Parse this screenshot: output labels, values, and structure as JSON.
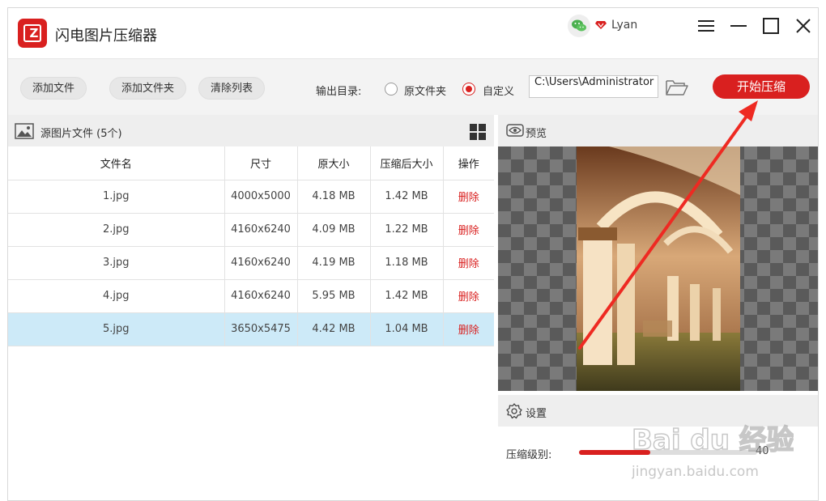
{
  "app": {
    "title": "闪电图片压缩器"
  },
  "user": {
    "name": "Lyan"
  },
  "toolbar": {
    "add_file": "添加文件",
    "add_folder": "添加文件夹",
    "clear_list": "清除列表",
    "output_label": "输出目录:",
    "option_original": "原文件夹",
    "option_custom": "自定义",
    "selected_option": "custom",
    "path_value": "C:\\Users\\Administrator",
    "start_button": "开始压缩"
  },
  "file_panel": {
    "title": "源图片文件 (5个)",
    "columns": [
      "文件名",
      "尺寸",
      "原大小",
      "压缩后大小",
      "操作"
    ],
    "rows": [
      {
        "name": "1.jpg",
        "size": "4000x5000",
        "original": "4.18 MB",
        "compressed": "1.42 MB",
        "action": "删除"
      },
      {
        "name": "2.jpg",
        "size": "4160x6240",
        "original": "4.09 MB",
        "compressed": "1.22 MB",
        "action": "删除"
      },
      {
        "name": "3.jpg",
        "size": "4160x6240",
        "original": "4.19 MB",
        "compressed": "1.18 MB",
        "action": "删除"
      },
      {
        "name": "4.jpg",
        "size": "4160x6240",
        "original": "5.95 MB",
        "compressed": "1.42 MB",
        "action": "删除"
      },
      {
        "name": "5.jpg",
        "size": "3650x5475",
        "original": "4.42 MB",
        "compressed": "1.04 MB",
        "action": "删除"
      }
    ],
    "selected_row": 4
  },
  "preview": {
    "title": "预览"
  },
  "settings": {
    "title": "设置",
    "level_label": "压缩级别:",
    "level_value": "40",
    "level_fraction": 0.4
  },
  "watermark": {
    "text": "Bai du 经验",
    "url_text": "jingyan.baidu.com"
  },
  "colors": {
    "accent": "#d9201f",
    "selected_row": "#cdeaf8",
    "header_bg": "#eeeeee",
    "wechat": "#4caf50"
  },
  "icons": [
    "app-logo-icon",
    "wechat-icon",
    "vip-diamond-icon",
    "menu-icon",
    "minimize-icon",
    "maximize-icon",
    "close-icon",
    "folder-open-icon",
    "image-icon",
    "grid-view-icon",
    "eye-icon",
    "gear-icon"
  ]
}
